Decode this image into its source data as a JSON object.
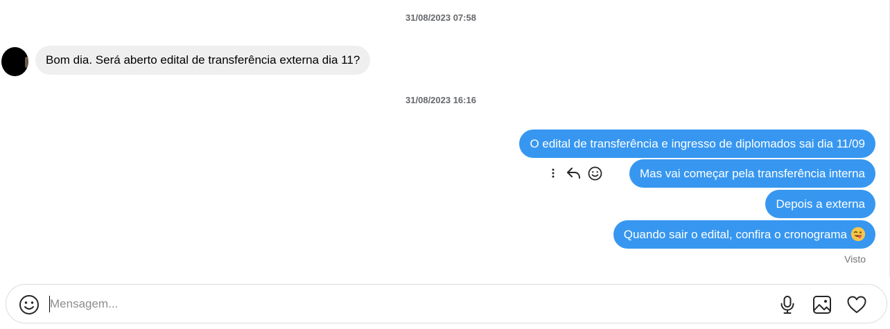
{
  "conversation": {
    "messages_group1": {
      "timestamp": "31/08/2023 07:58",
      "incoming": "Bom dia. Será aberto edital de transferência externa dia 11?"
    },
    "messages_group2": {
      "timestamp": "31/08/2023 16:16",
      "outgoing": [
        "O edital de transferência e ingresso de diplomados sai dia 11/09",
        "Mas vai começar pela transferência interna",
        "Depois a externa",
        "Quando sair o edital, confira o cronograma"
      ],
      "last_message_emoji": "winking-face-with-tongue",
      "seen_label": "Visto"
    },
    "message_actions": [
      "more-icon",
      "reply-icon",
      "react-emoji-icon"
    ]
  },
  "composer": {
    "placeholder": "Mensagem...",
    "value": "",
    "left_icon": "emoji-icon",
    "right_icons": [
      "microphone-icon",
      "image-icon",
      "heart-icon"
    ]
  },
  "colors": {
    "outgoing_bubble": "#3797f0",
    "incoming_bubble": "#efefef",
    "timestamp_text": "#65676b",
    "seen_text": "#737373"
  }
}
